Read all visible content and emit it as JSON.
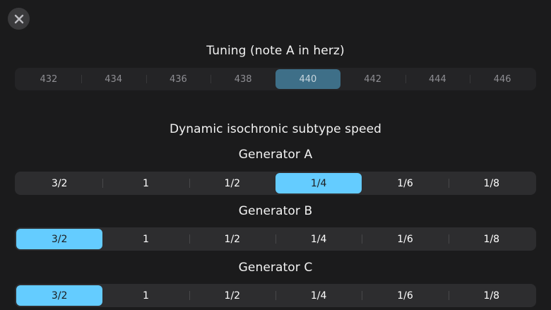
{
  "close_button": {
    "icon": "close-icon"
  },
  "tuning": {
    "title": "Tuning (note A in herz)",
    "options": [
      "432",
      "434",
      "436",
      "438",
      "440",
      "442",
      "444",
      "446"
    ],
    "selected": "440"
  },
  "speed_section": {
    "title": "Dynamic isochronic subtype speed"
  },
  "generators": [
    {
      "label": "Generator A",
      "options": [
        "3/2",
        "1",
        "1/2",
        "1/4",
        "1/6",
        "1/8"
      ],
      "selected": "1/4"
    },
    {
      "label": "Generator B",
      "options": [
        "3/2",
        "1",
        "1/2",
        "1/4",
        "1/6",
        "1/8"
      ],
      "selected": "3/2"
    },
    {
      "label": "Generator C",
      "options": [
        "3/2",
        "1",
        "1/2",
        "1/4",
        "1/6",
        "1/8"
      ],
      "selected": "3/2"
    }
  ],
  "colors": {
    "background": "#1b1b1c",
    "selected_accent": "#64ccff",
    "tuning_selected": "#3e6f88"
  }
}
